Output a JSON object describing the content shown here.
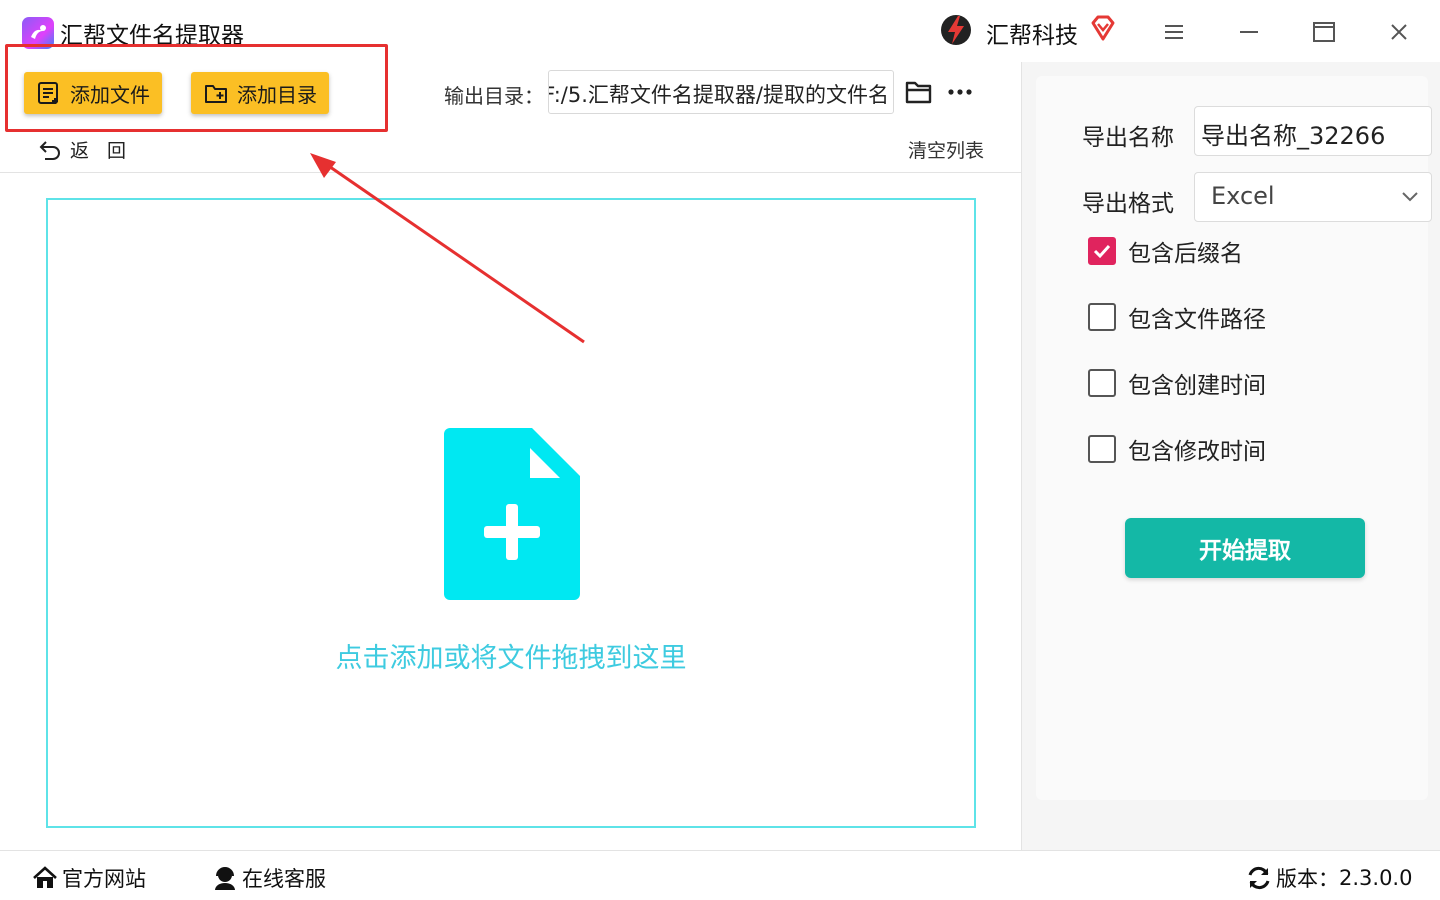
{
  "window": {
    "title": "汇帮文件名提取器",
    "brand_name": "汇帮科技"
  },
  "toolbar": {
    "add_file_label": "添加文件",
    "add_dir_label": "添加目录",
    "output_label": "输出目录：",
    "output_path": "F:/5.汇帮文件名提取器/提取的文件名",
    "back_label": "返回",
    "clear_label": "清空列表"
  },
  "dropzone": {
    "hint": "点击添加或将文件拖拽到这里"
  },
  "settings": {
    "export_name_label": "导出名称",
    "export_name_value": "导出名称_32266",
    "export_format_label": "导出格式",
    "export_format_value": "Excel",
    "options": [
      {
        "label": "包含后缀名",
        "checked": true
      },
      {
        "label": "包含文件路径",
        "checked": false
      },
      {
        "label": "包含创建时间",
        "checked": false
      },
      {
        "label": "包含修改时间",
        "checked": false
      }
    ],
    "start_label": "开始提取"
  },
  "footer": {
    "website_label": "官方网站",
    "support_label": "在线客服",
    "version_label": "版本：",
    "version_value": "2.3.0.0"
  },
  "colors": {
    "accent_yellow": "#fbbf24",
    "accent_teal": "#14b8a6",
    "drop_cyan": "#00e5f0",
    "checkbox_red": "#e0245e",
    "annotation_red": "#e63030"
  }
}
